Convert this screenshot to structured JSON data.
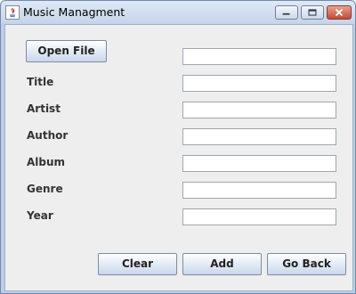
{
  "window": {
    "title": "Music Managment",
    "controls": [
      "minimize-icon",
      "maximize-icon",
      "close-icon"
    ]
  },
  "form": {
    "open_file_label": "Open File",
    "file_path_value": "",
    "fields": [
      {
        "label": "Title",
        "value": ""
      },
      {
        "label": "Artist",
        "value": ""
      },
      {
        "label": "Author",
        "value": ""
      },
      {
        "label": "Album",
        "value": ""
      },
      {
        "label": "Genre",
        "value": ""
      },
      {
        "label": "Year",
        "value": ""
      }
    ]
  },
  "buttons": {
    "clear_label": "Clear",
    "add_label": "Add",
    "go_back_label": "Go Back"
  }
}
